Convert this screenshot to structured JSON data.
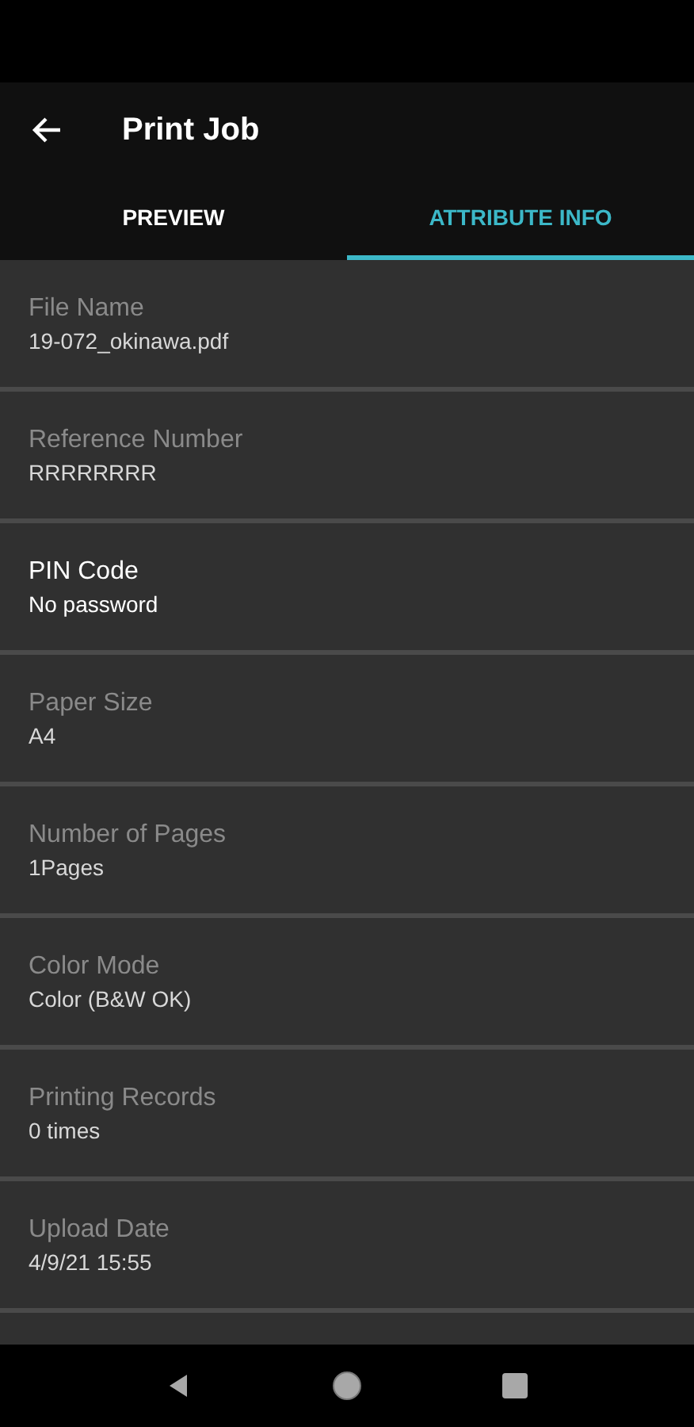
{
  "app_bar": {
    "title": "Print Job"
  },
  "tabs": [
    {
      "label": "PREVIEW",
      "selected": false
    },
    {
      "label": "ATTRIBUTE INFO",
      "selected": true
    }
  ],
  "fields": [
    {
      "label": "File Name",
      "value": "19-072_okinawa.pdf",
      "disabled": true
    },
    {
      "label": "Reference Number",
      "value": "RRRRRRRR",
      "disabled": true
    },
    {
      "label": "PIN Code",
      "value": "No password",
      "disabled": false
    },
    {
      "label": "Paper Size",
      "value": "A4",
      "disabled": true
    },
    {
      "label": "Number of Pages",
      "value": "1Pages",
      "disabled": true
    },
    {
      "label": "Color Mode",
      "value": "Color (B&W OK)",
      "disabled": true
    },
    {
      "label": "Printing Records",
      "value": "0 times",
      "disabled": true
    },
    {
      "label": "Upload Date",
      "value": "4/9/21 15:55",
      "disabled": true
    }
  ]
}
